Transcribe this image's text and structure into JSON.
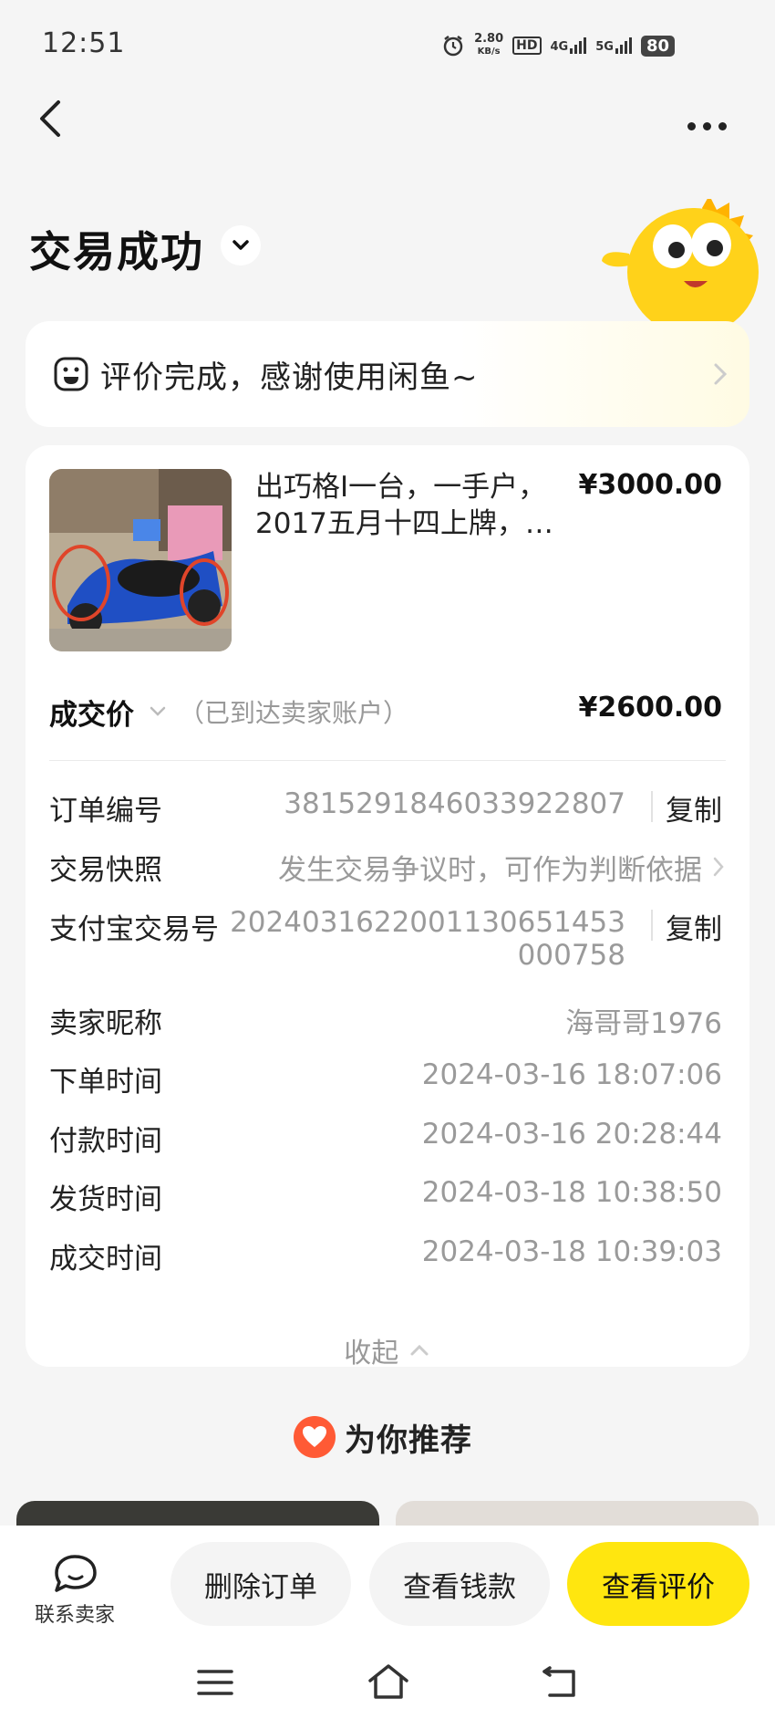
{
  "status_bar": {
    "time": "12:51",
    "speed_value": "2.80",
    "speed_unit": "KB/s",
    "hd": "HD",
    "network_4g": "4G",
    "network_5g": "5G",
    "battery": "80"
  },
  "header": {
    "back_icon": "chevron-left-icon",
    "more_icon": "more-horizontal-icon",
    "status_title": "交易成功"
  },
  "review_banner": {
    "text": "评价完成，感谢使用闲鱼~"
  },
  "product": {
    "title": "出巧格I一台，一手户，2017五月十四上牌，…",
    "price": "¥3000.00"
  },
  "deal": {
    "label": "成交价",
    "note": "（已到达卖家账户）",
    "price": "¥2600.00"
  },
  "details": {
    "order_no_label": "订单编号",
    "order_no": "3815291846033922807",
    "copy_label": "复制",
    "snapshot_label": "交易快照",
    "snapshot_value": "发生交易争议时，可作为判断依据",
    "alipay_label": "支付宝交易号",
    "alipay_line1": "20240316220011306514​53",
    "alipay_line2": "000758",
    "seller_label": "卖家昵称",
    "seller_value": "海哥哥1976",
    "order_time_label": "下单时间",
    "order_time": "2024-03-16 18:07:06",
    "pay_time_label": "付款时间",
    "pay_time": "2024-03-16 20:28:44",
    "ship_time_label": "发货时间",
    "ship_time": "2024-03-18 10:38:50",
    "deal_time_label": "成交时间",
    "deal_time": "2024-03-18 10:39:03",
    "collapse_label": "收起"
  },
  "recommend": {
    "title": "为你推荐"
  },
  "bottom_bar": {
    "contact_label": "联系卖家",
    "delete_label": "删除订单",
    "view_money_label": "查看钱款",
    "view_review_label": "查看评价"
  },
  "colors": {
    "accent_yellow": "#ffe60f",
    "heart_red": "#ff5a35",
    "background": "#f5f5f5"
  }
}
